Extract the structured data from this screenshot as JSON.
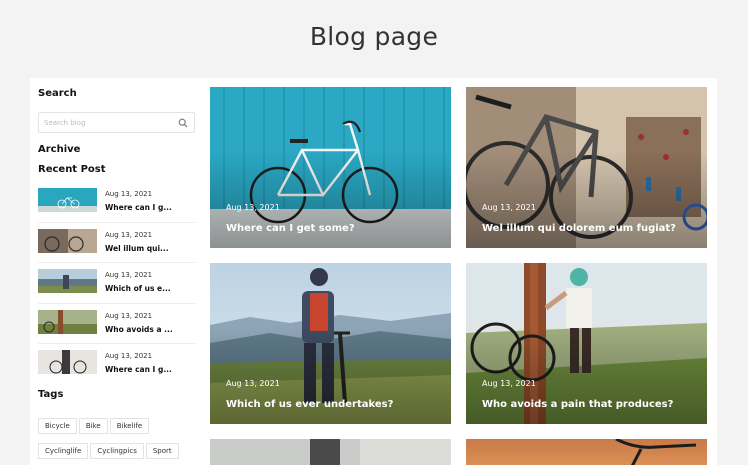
{
  "page": {
    "title": "Blog page"
  },
  "sidebar": {
    "search_heading": "Search",
    "search_placeholder": "Search blog",
    "archive_heading": "Archive",
    "recent_heading": "Recent Post",
    "recent_posts": [
      {
        "date": "Aug 13, 2021",
        "title": "Where can I g..."
      },
      {
        "date": "Aug 13, 2021",
        "title": "Wel illum qui..."
      },
      {
        "date": "Aug 13, 2021",
        "title": "Which of us e..."
      },
      {
        "date": "Aug 13, 2021",
        "title": "Who avoids a ..."
      },
      {
        "date": "Aug 13, 2021",
        "title": "Where can I g..."
      }
    ],
    "tags_heading": "Tags",
    "tags": [
      "Bicycle",
      "Bike",
      "Bikelife",
      "Cyclinglife",
      "Cyclingpics",
      "Sport"
    ]
  },
  "posts": [
    {
      "date": "Aug 13, 2021",
      "title": "Where can I get some?"
    },
    {
      "date": "Aug 13, 2021",
      "title": "Wel illum qui dolorem eum fugiat?"
    },
    {
      "date": "Aug 13, 2021",
      "title": "Which of us ever undertakes?"
    },
    {
      "date": "Aug 13, 2021",
      "title": "Who avoids a pain that produces?"
    }
  ]
}
